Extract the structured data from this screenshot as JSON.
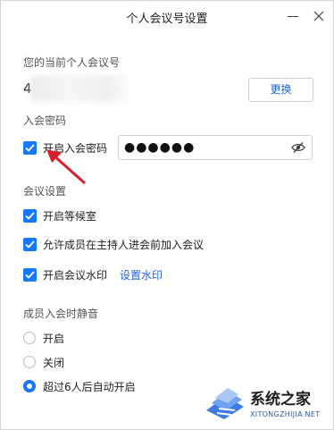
{
  "window": {
    "title": "个人会议号设置"
  },
  "meeting_id": {
    "section_label": "您的当前个人会议号",
    "visible_digit": "4",
    "change_button": "更换"
  },
  "password": {
    "section_label": "入会密码",
    "enable_label": "开启入会密码",
    "enabled": true,
    "masked_value": "●●●●●●"
  },
  "settings": {
    "section_label": "会议设置",
    "items": [
      {
        "label": "开启等候室",
        "checked": true
      },
      {
        "label": "允许成员在主持人进会前加入会议",
        "checked": true
      },
      {
        "label": "开启会议水印",
        "checked": true,
        "link": "设置水印"
      }
    ]
  },
  "mute": {
    "section_label": "成员入会时静音",
    "options": [
      {
        "label": "开启",
        "selected": false
      },
      {
        "label": "关闭",
        "selected": false
      },
      {
        "label": "超过6人后自动开启",
        "selected": true
      }
    ]
  },
  "watermark": {
    "brand": "系统之家",
    "url": "XITONGZHIJIA.NET"
  },
  "colors": {
    "accent": "#1677ff",
    "link": "#1f64d8",
    "arrow": "#d9202a"
  }
}
